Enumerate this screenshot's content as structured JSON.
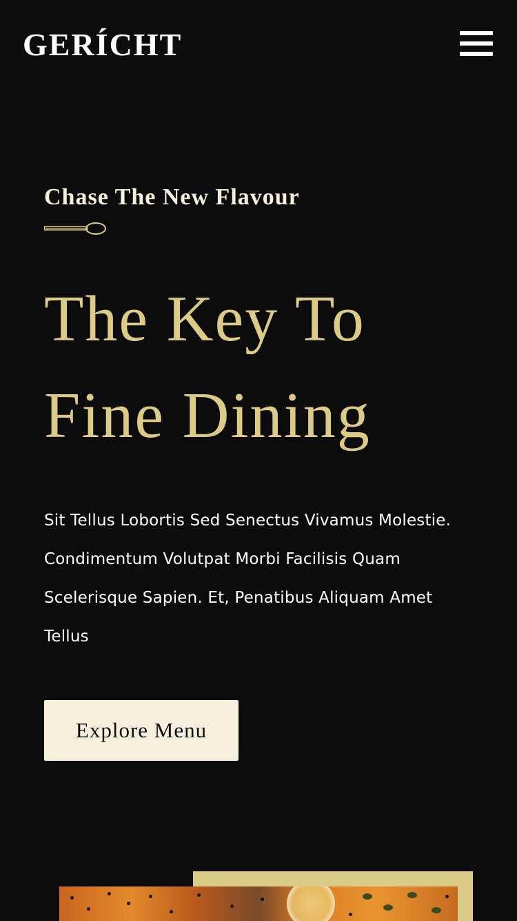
{
  "navbar": {
    "logo": "GERÍCHT",
    "menu_icon": "hamburger-menu-icon"
  },
  "hero": {
    "subtitle": "Chase The New Flavour",
    "divider_icon": "spoon-icon",
    "headline_line1": "The Key To",
    "headline_line2": "Fine Dining",
    "body": "Sit Tellus Lobortis Sed Senectus Vivamus Molestie. Condimentum Volutpat Morbi Facilisis Quam Scelerisque Sapien. Et, Penatibus Aliquam Amet Tellus",
    "button_label": "Explore Menu",
    "image_icon": "food-photo"
  },
  "colors": {
    "background": "#0c0c0c",
    "gold": "#dcca87",
    "cream": "#f5efdb",
    "white": "#ffffff"
  }
}
